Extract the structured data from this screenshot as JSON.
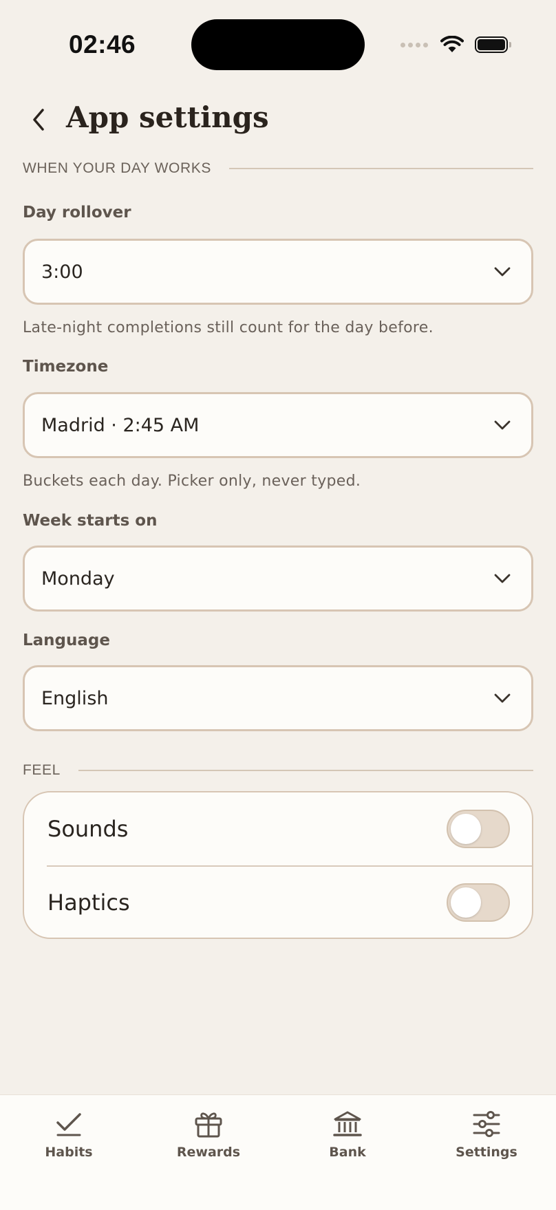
{
  "status_bar": {
    "time": "02:46",
    "icons": [
      "signal-dots-icon",
      "wifi-icon",
      "battery-icon"
    ]
  },
  "header": {
    "title": "App settings",
    "back_icon": "chevron-left-icon"
  },
  "sections": {
    "day": {
      "title": "WHEN YOUR DAY WORKS"
    },
    "feel": {
      "title": "FEEL"
    }
  },
  "fields": {
    "day_rollover": {
      "label": "Day rollover",
      "value": "3:00",
      "helper": "Late-night completions still count for the day before."
    },
    "timezone": {
      "label": "Timezone",
      "value": "Madrid · 2:45 AM",
      "helper": "Buckets each day. Picker only, never typed."
    },
    "week_start": {
      "label": "Week starts on",
      "value": "Monday"
    },
    "language": {
      "label": "Language",
      "value": "English"
    }
  },
  "feel": {
    "sounds": {
      "label": "Sounds",
      "on": false
    },
    "haptics": {
      "label": "Haptics",
      "on": false
    }
  },
  "tabbar": {
    "items": [
      {
        "label": "Habits",
        "icon": "check-icon"
      },
      {
        "label": "Rewards",
        "icon": "gift-icon"
      },
      {
        "label": "Bank",
        "icon": "bank-icon"
      },
      {
        "label": "Settings",
        "icon": "sliders-icon"
      }
    ]
  },
  "colors": {
    "background": "#f4f0ea",
    "card": "#fdfcf9",
    "border": "#d7c5b3",
    "text": "#2a2520",
    "muted": "#6a615a"
  }
}
